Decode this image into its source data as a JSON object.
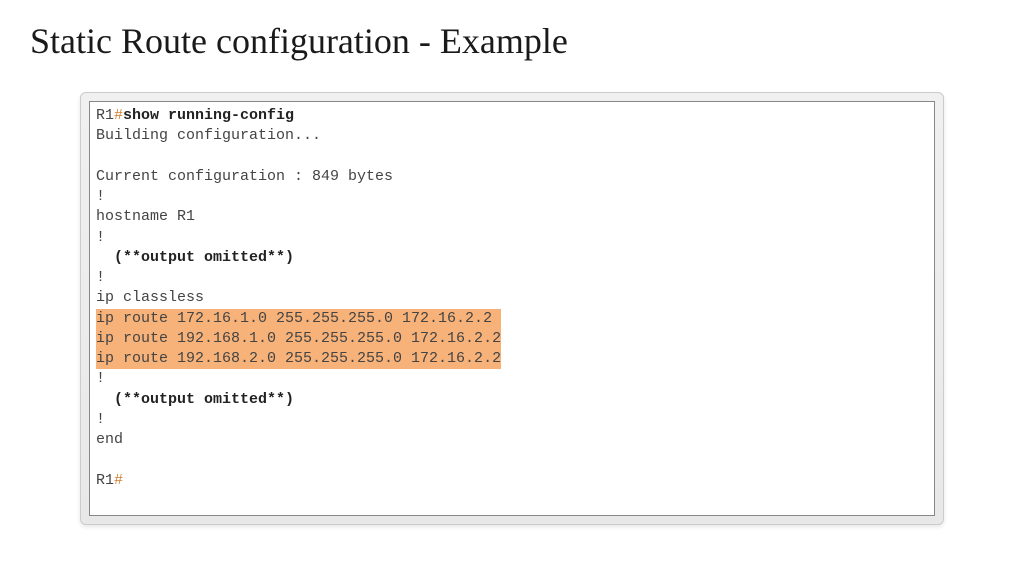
{
  "title": "Static Route configuration - Example",
  "terminal": {
    "prompt": "R1",
    "hash": "#",
    "command": "show running-config",
    "lines": {
      "building": "Building configuration...",
      "current": "Current configuration : 849 bytes",
      "bang1": "!",
      "hostname": "hostname R1",
      "bang2": "!",
      "omitted1": "  (**output omitted**)",
      "bang3": "!",
      "classless": "ip classless",
      "route1": "ip route 172.16.1.0 255.255.255.0 172.16.2.2 ",
      "route2": "ip route 192.168.1.0 255.255.255.0 172.16.2.2",
      "route3": "ip route 192.168.2.0 255.255.255.0 172.16.2.2",
      "bang4": "!",
      "omitted2": "  (**output omitted**)",
      "bang5": "!",
      "end": "end",
      "finalprompt": "R1",
      "finalhash": "#"
    }
  }
}
